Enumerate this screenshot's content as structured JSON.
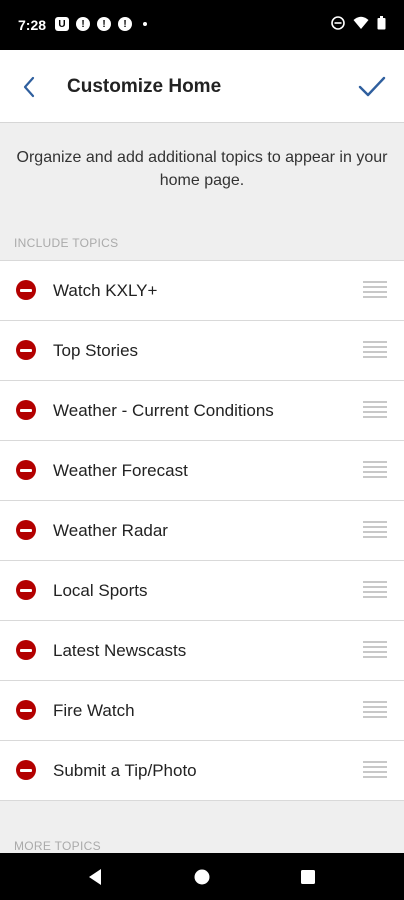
{
  "status_bar": {
    "time": "7:28",
    "left_icons": [
      "u-app-icon",
      "alert-icon",
      "alert-icon",
      "alert-icon",
      "dot-icon"
    ],
    "right_icons": [
      "do-not-disturb-icon",
      "wifi-icon",
      "battery-icon"
    ]
  },
  "header": {
    "title": "Customize Home",
    "back_icon": "chevron-left-icon",
    "done_icon": "checkmark-icon"
  },
  "description": "Organize and add additional topics to appear in your home page.",
  "sections": {
    "include_label": "INCLUDE TOPICS",
    "more_label": "MORE TOPICS"
  },
  "topics": [
    {
      "label": "Watch KXLY+"
    },
    {
      "label": "Top Stories"
    },
    {
      "label": "Weather - Current Conditions"
    },
    {
      "label": "Weather Forecast"
    },
    {
      "label": "Weather Radar"
    },
    {
      "label": "Local Sports"
    },
    {
      "label": "Latest Newscasts"
    },
    {
      "label": "Fire Watch"
    },
    {
      "label": "Submit a Tip/Photo"
    }
  ],
  "colors": {
    "accent": "#2f5f9e",
    "remove": "#b30000",
    "background": "#efefef"
  }
}
